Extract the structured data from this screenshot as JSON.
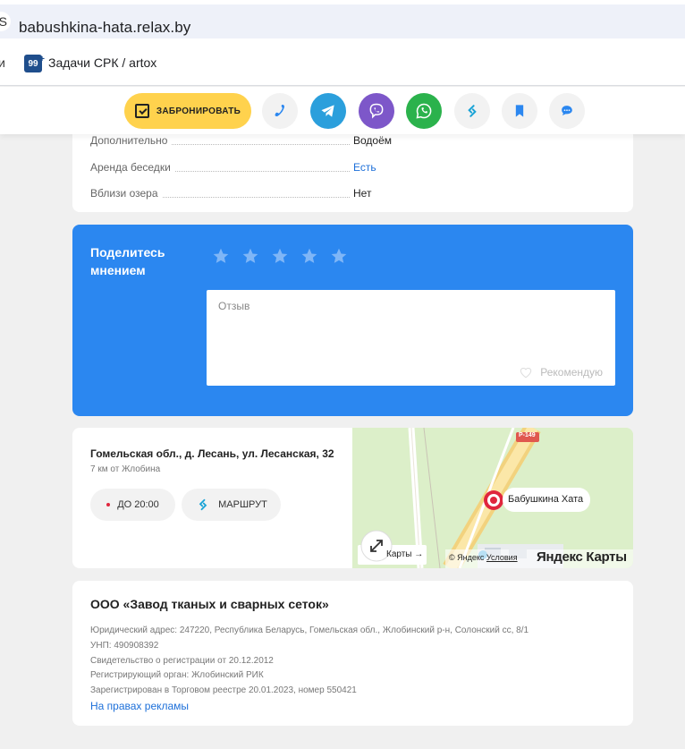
{
  "browser": {
    "site_icon": "S",
    "url": "babushkina-hata.relax.by",
    "bookmark_cut": "и",
    "bookmark_icon_text": "99",
    "bookmark_label": "Задачи СРК / artox"
  },
  "actions": {
    "book_label": "ЗАБРОНИРОВАТЬ",
    "icons": [
      "phone-icon",
      "telegram-icon",
      "viber-icon",
      "whatsapp-icon",
      "route-link-icon",
      "bookmark-icon",
      "chat-icon"
    ],
    "colors": {
      "book": "#ffd24d",
      "telegram": "#2b9fdc",
      "viber": "#7d57c9",
      "whatsapp": "#2bb24c"
    }
  },
  "details": {
    "rows": [
      {
        "key": "Дополнительно",
        "value": "Водоём"
      },
      {
        "key": "Аренда беседки",
        "value": "Есть"
      },
      {
        "key": "Вблизи озера",
        "value": "Нет"
      }
    ]
  },
  "review": {
    "title": "Поделитесь мнением",
    "stars": 5,
    "placeholder": "Отзыв",
    "recommend": "Рекомендую"
  },
  "location": {
    "address": "Гомельская обл., д. Лесань, ул. Лесанская, 32",
    "distance": "7 км от Жлобина",
    "hours": "ДО 20:00",
    "route": "МАРШРУТ",
    "map": {
      "road": "Р-149",
      "place": "Бабушкина Хата",
      "cut_label": "Карты →",
      "copyright": "© Яндекс",
      "terms": "Условия",
      "brand": "Яндекс Карты"
    }
  },
  "company": {
    "name": "ООО «Завод тканых и сварных сеток»",
    "lines": [
      "Юридический адрес: 247220, Республика Беларусь, Гомельская обл., Жлобинский р-н, Солонский сс, 8/1",
      "УНП: 490908392",
      "Свидетельство о регистрации от 20.12.2012",
      "Регистрирующий орган: Жлобинский РИК",
      "Зарегистрирован в Торговом реестре 20.01.2023, номер 550421"
    ],
    "ad_link": "На правах рекламы"
  }
}
